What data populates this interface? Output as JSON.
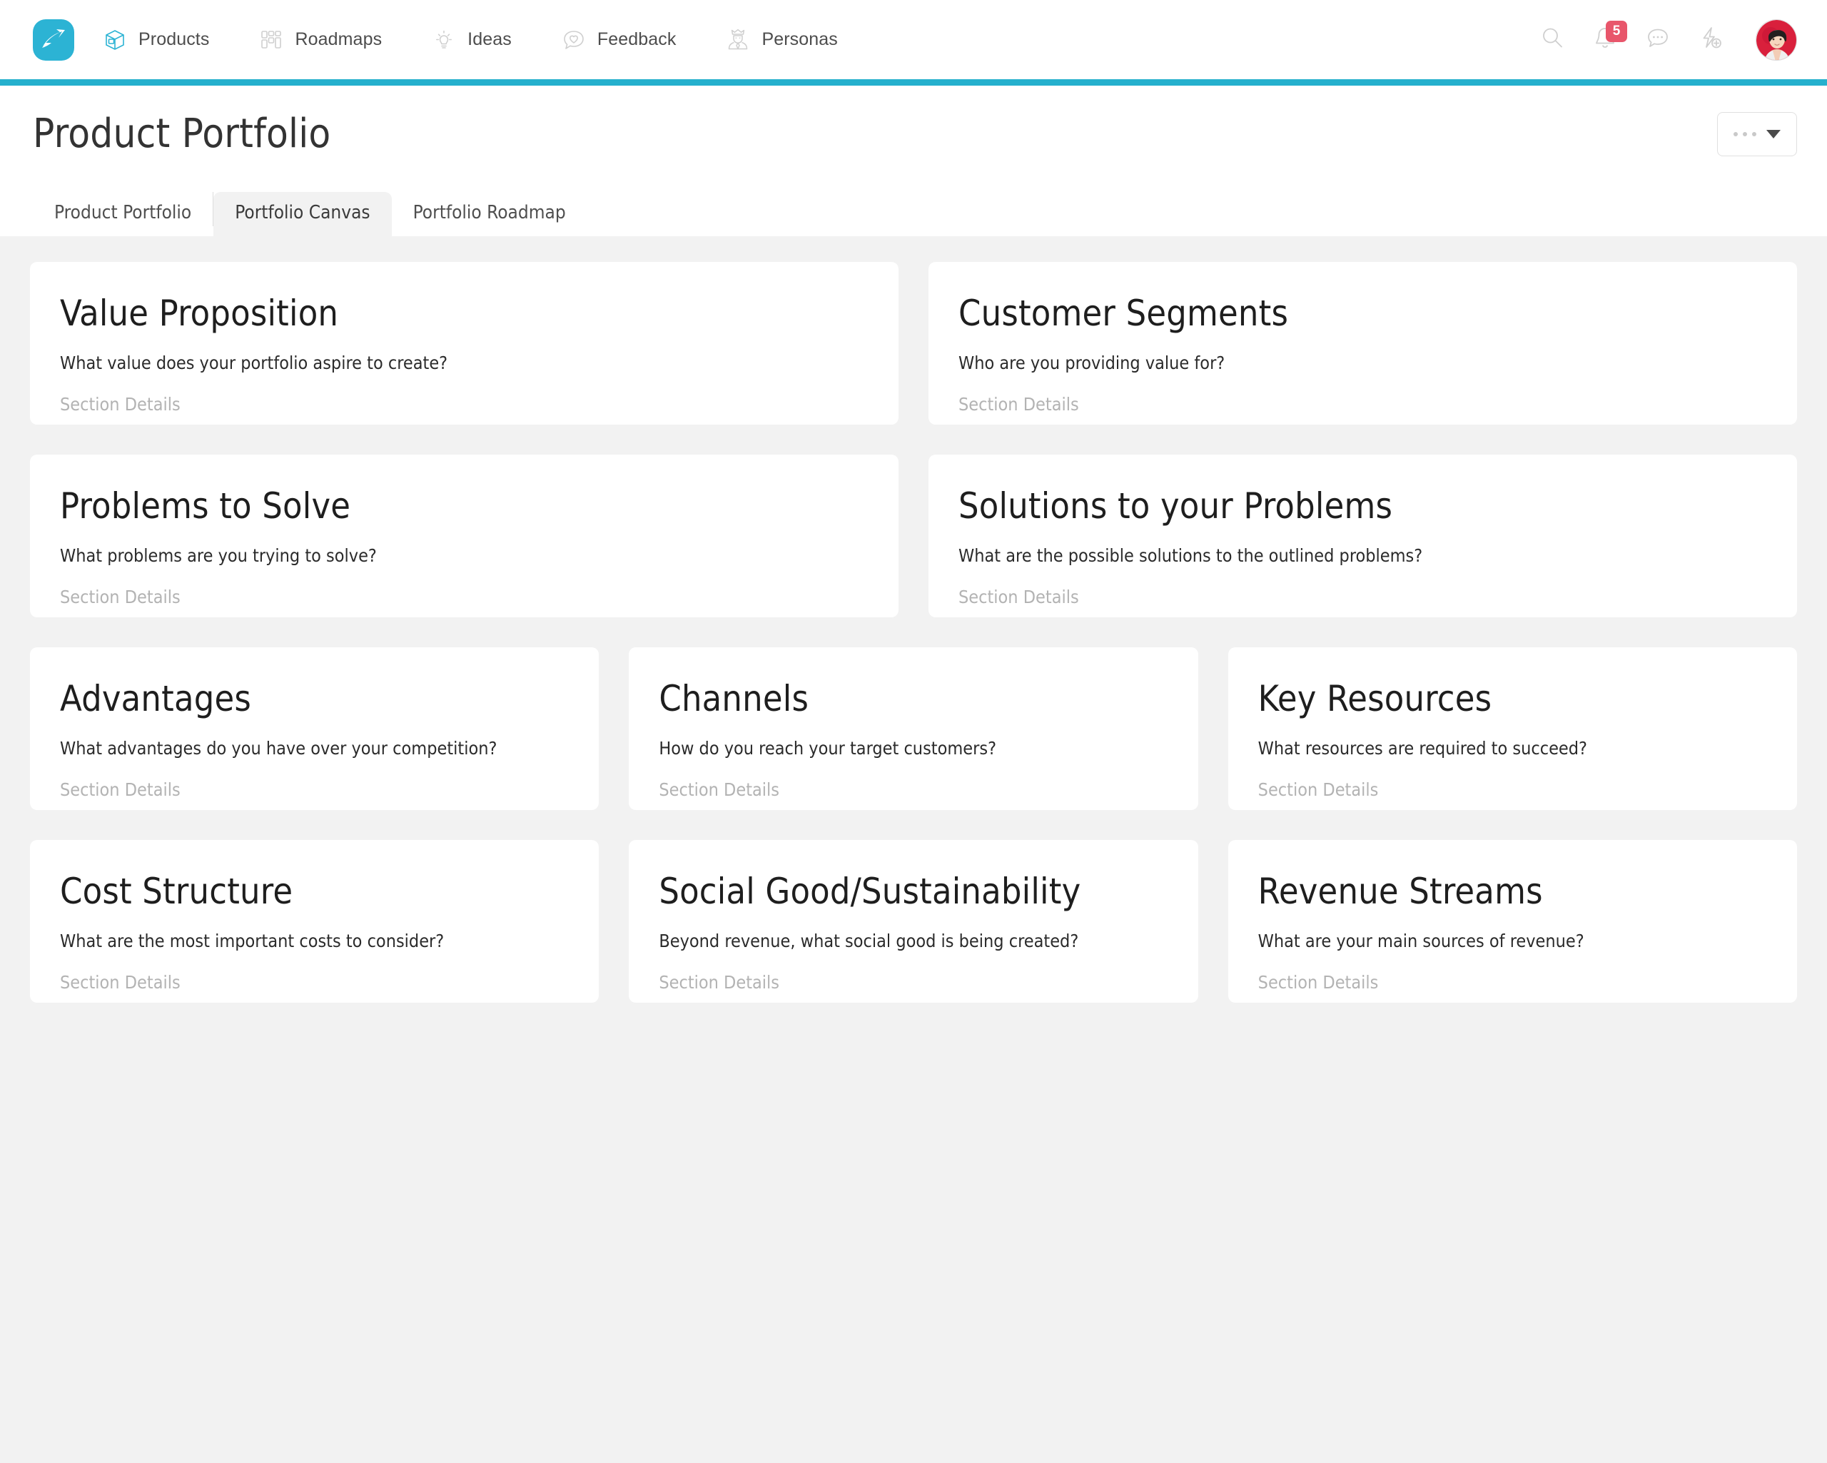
{
  "colors": {
    "brand_teal": "#2cb3d4",
    "accent_bar": "#25b0cd",
    "badge_red": "#e8566b",
    "canvas_bg": "#f2f2f2",
    "card_bg": "#ffffff"
  },
  "topnav": {
    "logo_name": "aha-logo",
    "items": [
      {
        "label": "Products",
        "icon": "box-icon"
      },
      {
        "label": "Roadmaps",
        "icon": "grid-icon"
      },
      {
        "label": "Ideas",
        "icon": "lightbulb-icon"
      },
      {
        "label": "Feedback",
        "icon": "heart-speech-bubble-icon"
      },
      {
        "label": "Personas",
        "icon": "crown-person-icon"
      }
    ],
    "actions": [
      {
        "name": "search-icon",
        "badge": ""
      },
      {
        "name": "notifications-icon",
        "badge": "5"
      },
      {
        "name": "comments-icon",
        "badge": ""
      },
      {
        "name": "quick-add-icon",
        "badge": ""
      }
    ],
    "avatar_label": "User avatar"
  },
  "header": {
    "title": "Product Portfolio",
    "menu_button_label": ""
  },
  "tabs": [
    {
      "label": "Product Portfolio",
      "active": false
    },
    {
      "label": "Portfolio Canvas",
      "active": true
    },
    {
      "label": "Portfolio Roadmap",
      "active": false
    }
  ],
  "canvas": {
    "details_placeholder": "Section Details",
    "rows": [
      {
        "columns": 2,
        "cards": [
          {
            "title": "Value Proposition",
            "question": "What value does your portfolio aspire to create?",
            "details": "Section Details"
          },
          {
            "title": "Customer Segments",
            "question": "Who are you providing value for?",
            "details": "Section Details"
          }
        ]
      },
      {
        "columns": 2,
        "cards": [
          {
            "title": "Problems to Solve",
            "question": "What problems are you trying to solve?",
            "details": "Section Details"
          },
          {
            "title": "Solutions to your Problems",
            "question": "What are the possible solutions to the outlined problems?",
            "details": "Section Details"
          }
        ]
      },
      {
        "columns": 3,
        "cards": [
          {
            "title": "Advantages",
            "question": "What advantages do you have over your competition?",
            "details": "Section Details"
          },
          {
            "title": "Channels",
            "question": "How do you reach your target customers?",
            "details": "Section Details"
          },
          {
            "title": "Key Resources",
            "question": "What resources are required to succeed?",
            "details": "Section Details"
          }
        ]
      },
      {
        "columns": 3,
        "cards": [
          {
            "title": "Cost Structure",
            "question": "What are the most important costs to consider?",
            "details": "Section Details"
          },
          {
            "title": "Social Good/Sustainability",
            "question": "Beyond revenue, what social good is being created?",
            "details": "Section Details"
          },
          {
            "title": "Revenue Streams",
            "question": "What are your main sources of revenue?",
            "details": "Section Details"
          }
        ]
      }
    ]
  }
}
